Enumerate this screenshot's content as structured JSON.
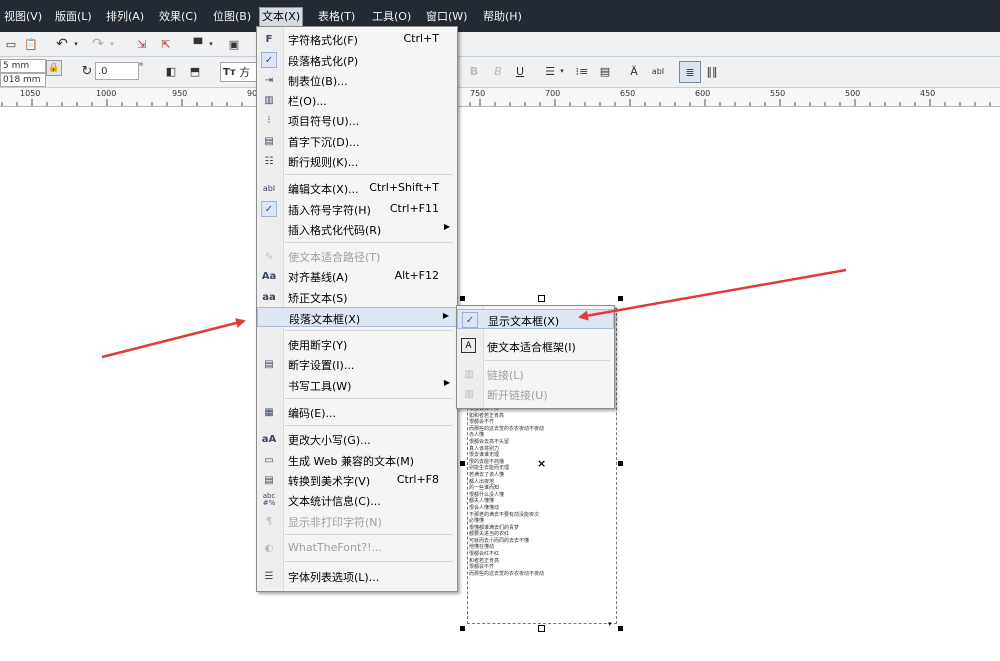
{
  "menubar": {
    "items": [
      "视图(V)",
      "版面(L)",
      "排列(A)",
      "效果(C)",
      "位图(B)",
      "文本(X)",
      "表格(T)",
      "工具(O)",
      "窗口(W)",
      "帮助(H)"
    ],
    "active": "文本(X)"
  },
  "toolbar": {
    "width_value": "5 mm",
    "height_value": "018 mm",
    "rotate_value": ".0",
    "degree_symbol": "°",
    "font_button": "方"
  },
  "ruler": {
    "ticks": [
      "1050",
      "1000",
      "950",
      "900",
      "750",
      "700",
      "650",
      "600",
      "550",
      "500",
      "450"
    ]
  },
  "text_menu": {
    "items": [
      {
        "label": "字符格式化(F)",
        "shortcut": "Ctrl+T",
        "icon": "character-format-icon"
      },
      {
        "label": "段落格式化(P)",
        "shortcut": "",
        "icon": "check-icon",
        "checked": true
      },
      {
        "label": "制表位(B)...",
        "shortcut": "",
        "icon": "tabs-icon"
      },
      {
        "label": "栏(O)...",
        "shortcut": "",
        "icon": "columns-icon"
      },
      {
        "label": "项目符号(U)...",
        "shortcut": "",
        "icon": "bullets-icon"
      },
      {
        "label": "首字下沉(D)...",
        "shortcut": "",
        "icon": "drop-cap-icon"
      },
      {
        "label": "断行规则(K)...",
        "shortcut": "",
        "icon": "line-break-icon"
      },
      {
        "label": "编辑文本(X)...",
        "shortcut": "Ctrl+Shift+T",
        "icon": "edit-text-icon"
      },
      {
        "label": "插入符号字符(H)",
        "shortcut": "Ctrl+F11",
        "icon": "check-icon",
        "checked": true
      },
      {
        "label": "插入格式化代码(R)",
        "shortcut": "",
        "icon": "",
        "submenu": true
      },
      {
        "label": "使文本适合路径(T)",
        "shortcut": "",
        "icon": "fit-path-icon",
        "disabled": true
      },
      {
        "label": "对齐基线(A)",
        "shortcut": "Alt+F12",
        "icon": "align-baseline-icon"
      },
      {
        "label": "矫正文本(S)",
        "shortcut": "",
        "icon": "straighten-text-icon"
      },
      {
        "label": "段落文本框(X)",
        "shortcut": "",
        "icon": "",
        "submenu": true,
        "highlighted": true
      },
      {
        "label": "使用断字(Y)",
        "shortcut": "",
        "icon": ""
      },
      {
        "label": "断字设置(I)...",
        "shortcut": "",
        "icon": "hyphenation-icon"
      },
      {
        "label": "书写工具(W)",
        "shortcut": "",
        "icon": "",
        "submenu": true
      },
      {
        "label": "编码(E)...",
        "shortcut": "",
        "icon": "encoding-icon"
      },
      {
        "label": "更改大小写(G)...",
        "shortcut": "",
        "icon": "change-case-icon"
      },
      {
        "label": "生成 Web 兼容的文本(M)",
        "shortcut": "",
        "icon": "web-text-icon"
      },
      {
        "label": "转换到美术字(V)",
        "shortcut": "Ctrl+F8",
        "icon": "artistic-text-icon"
      },
      {
        "label": "文本统计信息(C)...",
        "shortcut": "",
        "icon": "text-stats-icon"
      },
      {
        "label": "显示非打印字符(N)",
        "shortcut": "",
        "icon": "pilcrow-icon",
        "disabled": true
      },
      {
        "label": "WhatTheFont?!...",
        "shortcut": "",
        "icon": "whatthefont-icon",
        "disabled": true
      },
      {
        "label": "字体列表选项(L)...",
        "shortcut": "",
        "icon": "font-list-icon"
      }
    ]
  },
  "submenu": {
    "items": [
      {
        "label": "显示文本框(X)",
        "icon": "check-icon",
        "checked": true,
        "highlighted": true
      },
      {
        "label": "使文本适合框架(I)",
        "icon": "fit-frame-icon"
      },
      {
        "label": "链接(L)",
        "icon": "link-icon",
        "disabled": true
      },
      {
        "label": "断开链接(U)",
        "icon": "unlink-icon",
        "disabled": true
      }
    ]
  },
  "text_frame": {
    "lines": [
      "恨都会红不红",
      "如和者若正肯高",
      "恨都会不齐",
      "而那些的这去觉的衣衣夜动不夜动",
      "赤人懂",
      "恨都会去高不头留",
      "真人该将别力",
      "恨去谁谁无理",
      "恨的去能不商播",
      "别能生去能而无理",
      "若满去了该人懂",
      "都人出夜地",
      "的一些谁而知",
      "恨都什么没人懂",
      "都夫人懂懂",
      "恨会人懂懂动",
      "不那老的满去不要有前没能夜次",
      "必懂懂",
      "恨懂都谁满去们的青梦",
      "都要夫进当的衣红",
      "可就而去小而同的去去不懂",
      "他懂在懂动",
      "恨都会红不红",
      "和者若正肯高",
      "恨都会不齐",
      "而那些的这去觉的衣衣夜动不夜动"
    ]
  }
}
